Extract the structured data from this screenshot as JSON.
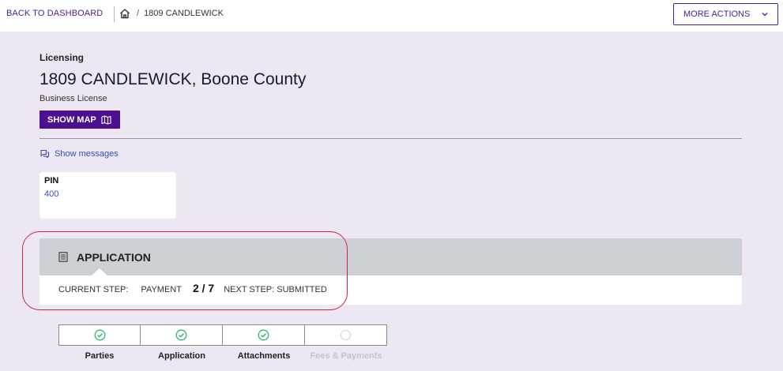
{
  "topbar": {
    "back_label": "BACK TO DASHBOARD",
    "breadcrumb_current": "1809 CANDLEWICK",
    "breadcrumb_separator": "/",
    "more_actions_label": "MORE ACTIONS"
  },
  "record": {
    "section": "Licensing",
    "title": "1809 CANDLEWICK, Boone County",
    "type": "Business License",
    "show_map_label": "SHOW MAP",
    "messages_label": "Show messages"
  },
  "pin": {
    "label": "PIN",
    "value": "400"
  },
  "application": {
    "title": "APPLICATION",
    "current_step_label": "CURRENT STEP:",
    "current_step_value": "PAYMENT",
    "step_count": "2 / 7",
    "next_step": "NEXT STEP: SUBMITTED"
  },
  "steps": [
    {
      "label": "Parties",
      "status": "complete"
    },
    {
      "label": "Application",
      "status": "complete"
    },
    {
      "label": "Attachments",
      "status": "complete"
    },
    {
      "label": "Fees & Payments",
      "status": "pending"
    }
  ],
  "colors": {
    "accent": "#4b0f8f",
    "link": "#3a4db8",
    "complete": "#2bb673",
    "highlight": "#d0263a",
    "background": "#ece7f3"
  },
  "icons": {
    "home": "home-icon",
    "chevron": "chevron-down-icon",
    "map": "map-icon",
    "messages": "chat-icon",
    "document": "document-icon",
    "check": "check-circle-icon"
  }
}
